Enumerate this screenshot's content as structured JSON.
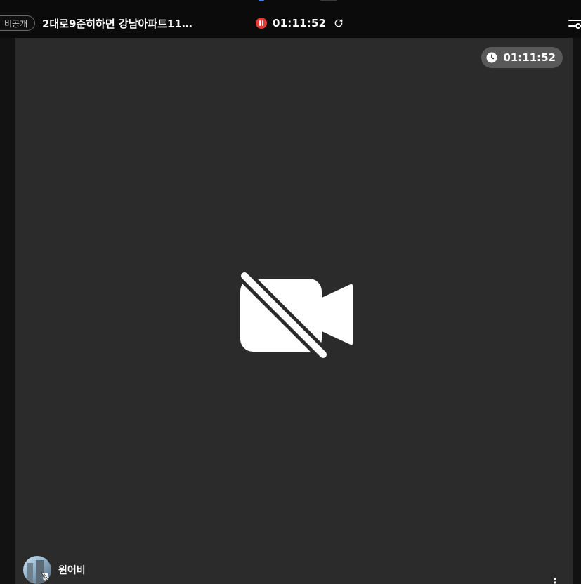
{
  "header": {
    "badge": "비공개",
    "title": "2대로9준히하면 강남아파트11…",
    "recording_time": "01:11:52"
  },
  "stage": {
    "timer": "01:11:52",
    "camera_status_icon": "video-off-icon"
  },
  "participant": {
    "name": "원어비"
  },
  "icons": {
    "pause": "pause-icon",
    "refresh": "refresh-icon",
    "settings": "settings-icon",
    "clock": "clock-icon",
    "mic_off": "mic-off-icon",
    "more": "more-icon"
  },
  "colors": {
    "stage_bg": "#2b2b2b",
    "recording_red": "#e53935",
    "accent_blue": "#3b82f6"
  }
}
